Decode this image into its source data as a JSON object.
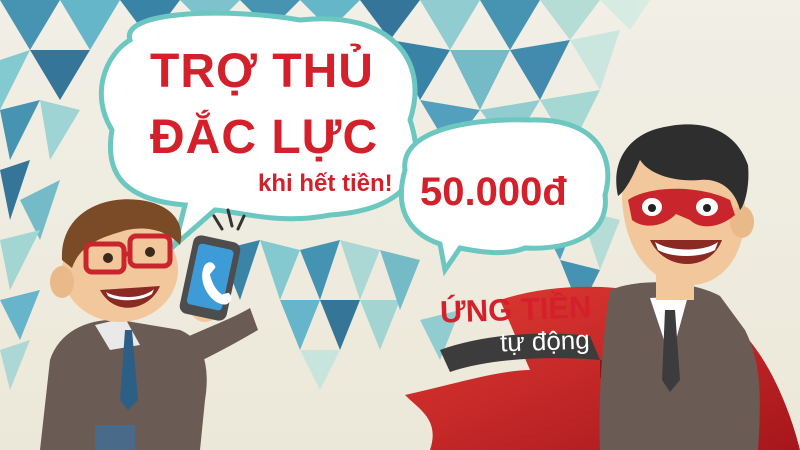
{
  "headline": {
    "line1": "TRỢ THỦ",
    "line2": "ĐẮC LỰC",
    "line3": "khi hết tiền!"
  },
  "price": "50.000đ",
  "ribbon": {
    "line1": "ỨNG TIỀN",
    "line2": "tự động"
  },
  "colors": {
    "brand_red": "#d4202a",
    "bubble_stroke": "#6cc7c1",
    "banner_dark": "#3c3c3c"
  }
}
